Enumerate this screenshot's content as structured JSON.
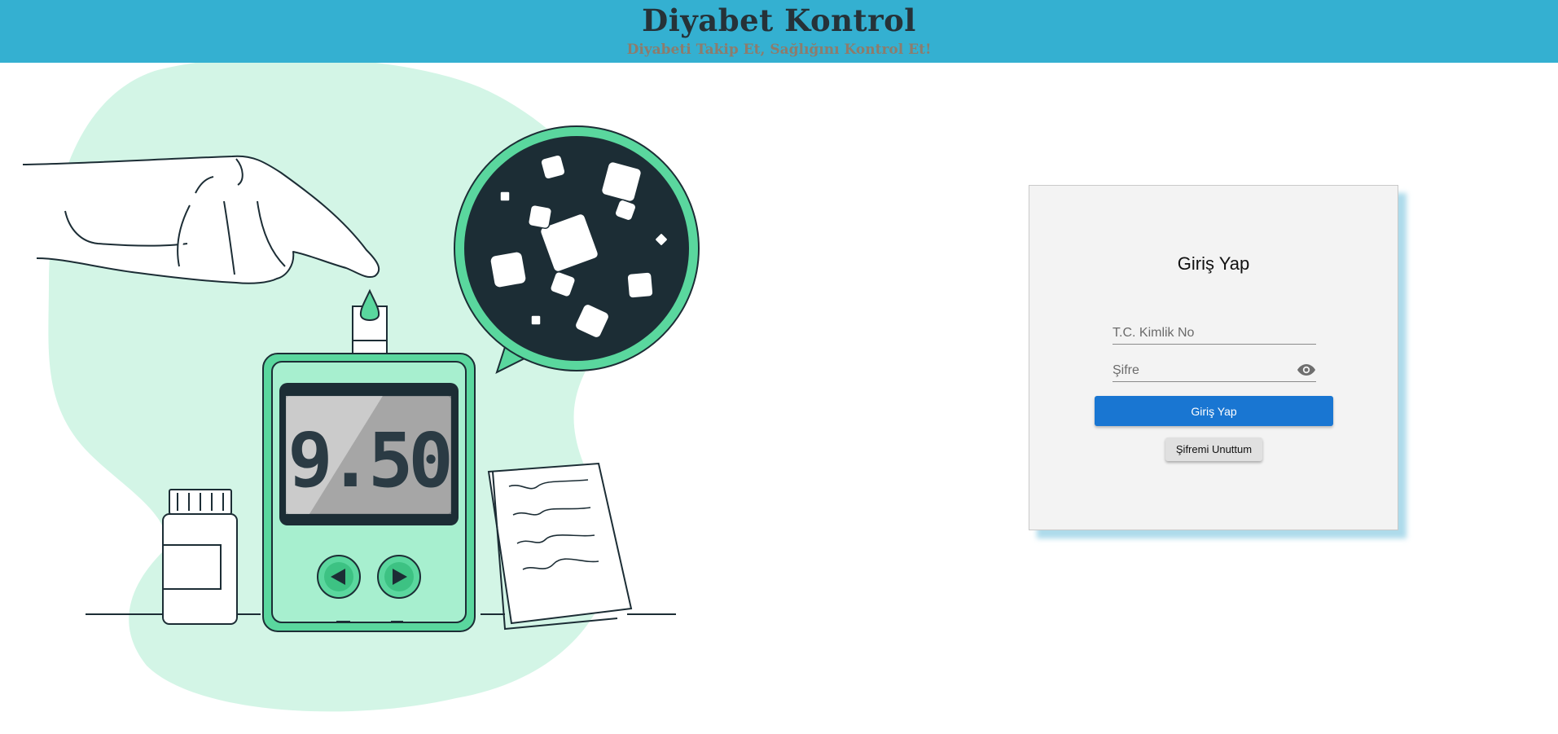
{
  "header": {
    "title": "Diyabet Kontrol",
    "subtitle": "Diyabeti Takip Et, Sağlığını Kontrol Et!"
  },
  "illustration": {
    "meter_reading": "9.50",
    "icon": "glucose-meter-illustration"
  },
  "login": {
    "title": "Giriş Yap",
    "tc_placeholder": "T.C. Kimlik No",
    "tc_value": "",
    "password_placeholder": "Şifre",
    "password_value": "",
    "submit_label": "Giriş Yap",
    "forgot_label": "Şifremi Unuttum"
  },
  "colors": {
    "header_bg": "#34b0d1",
    "primary_button": "#1976d2",
    "accent_green": "#5ad79e",
    "dark": "#1c2d35"
  }
}
